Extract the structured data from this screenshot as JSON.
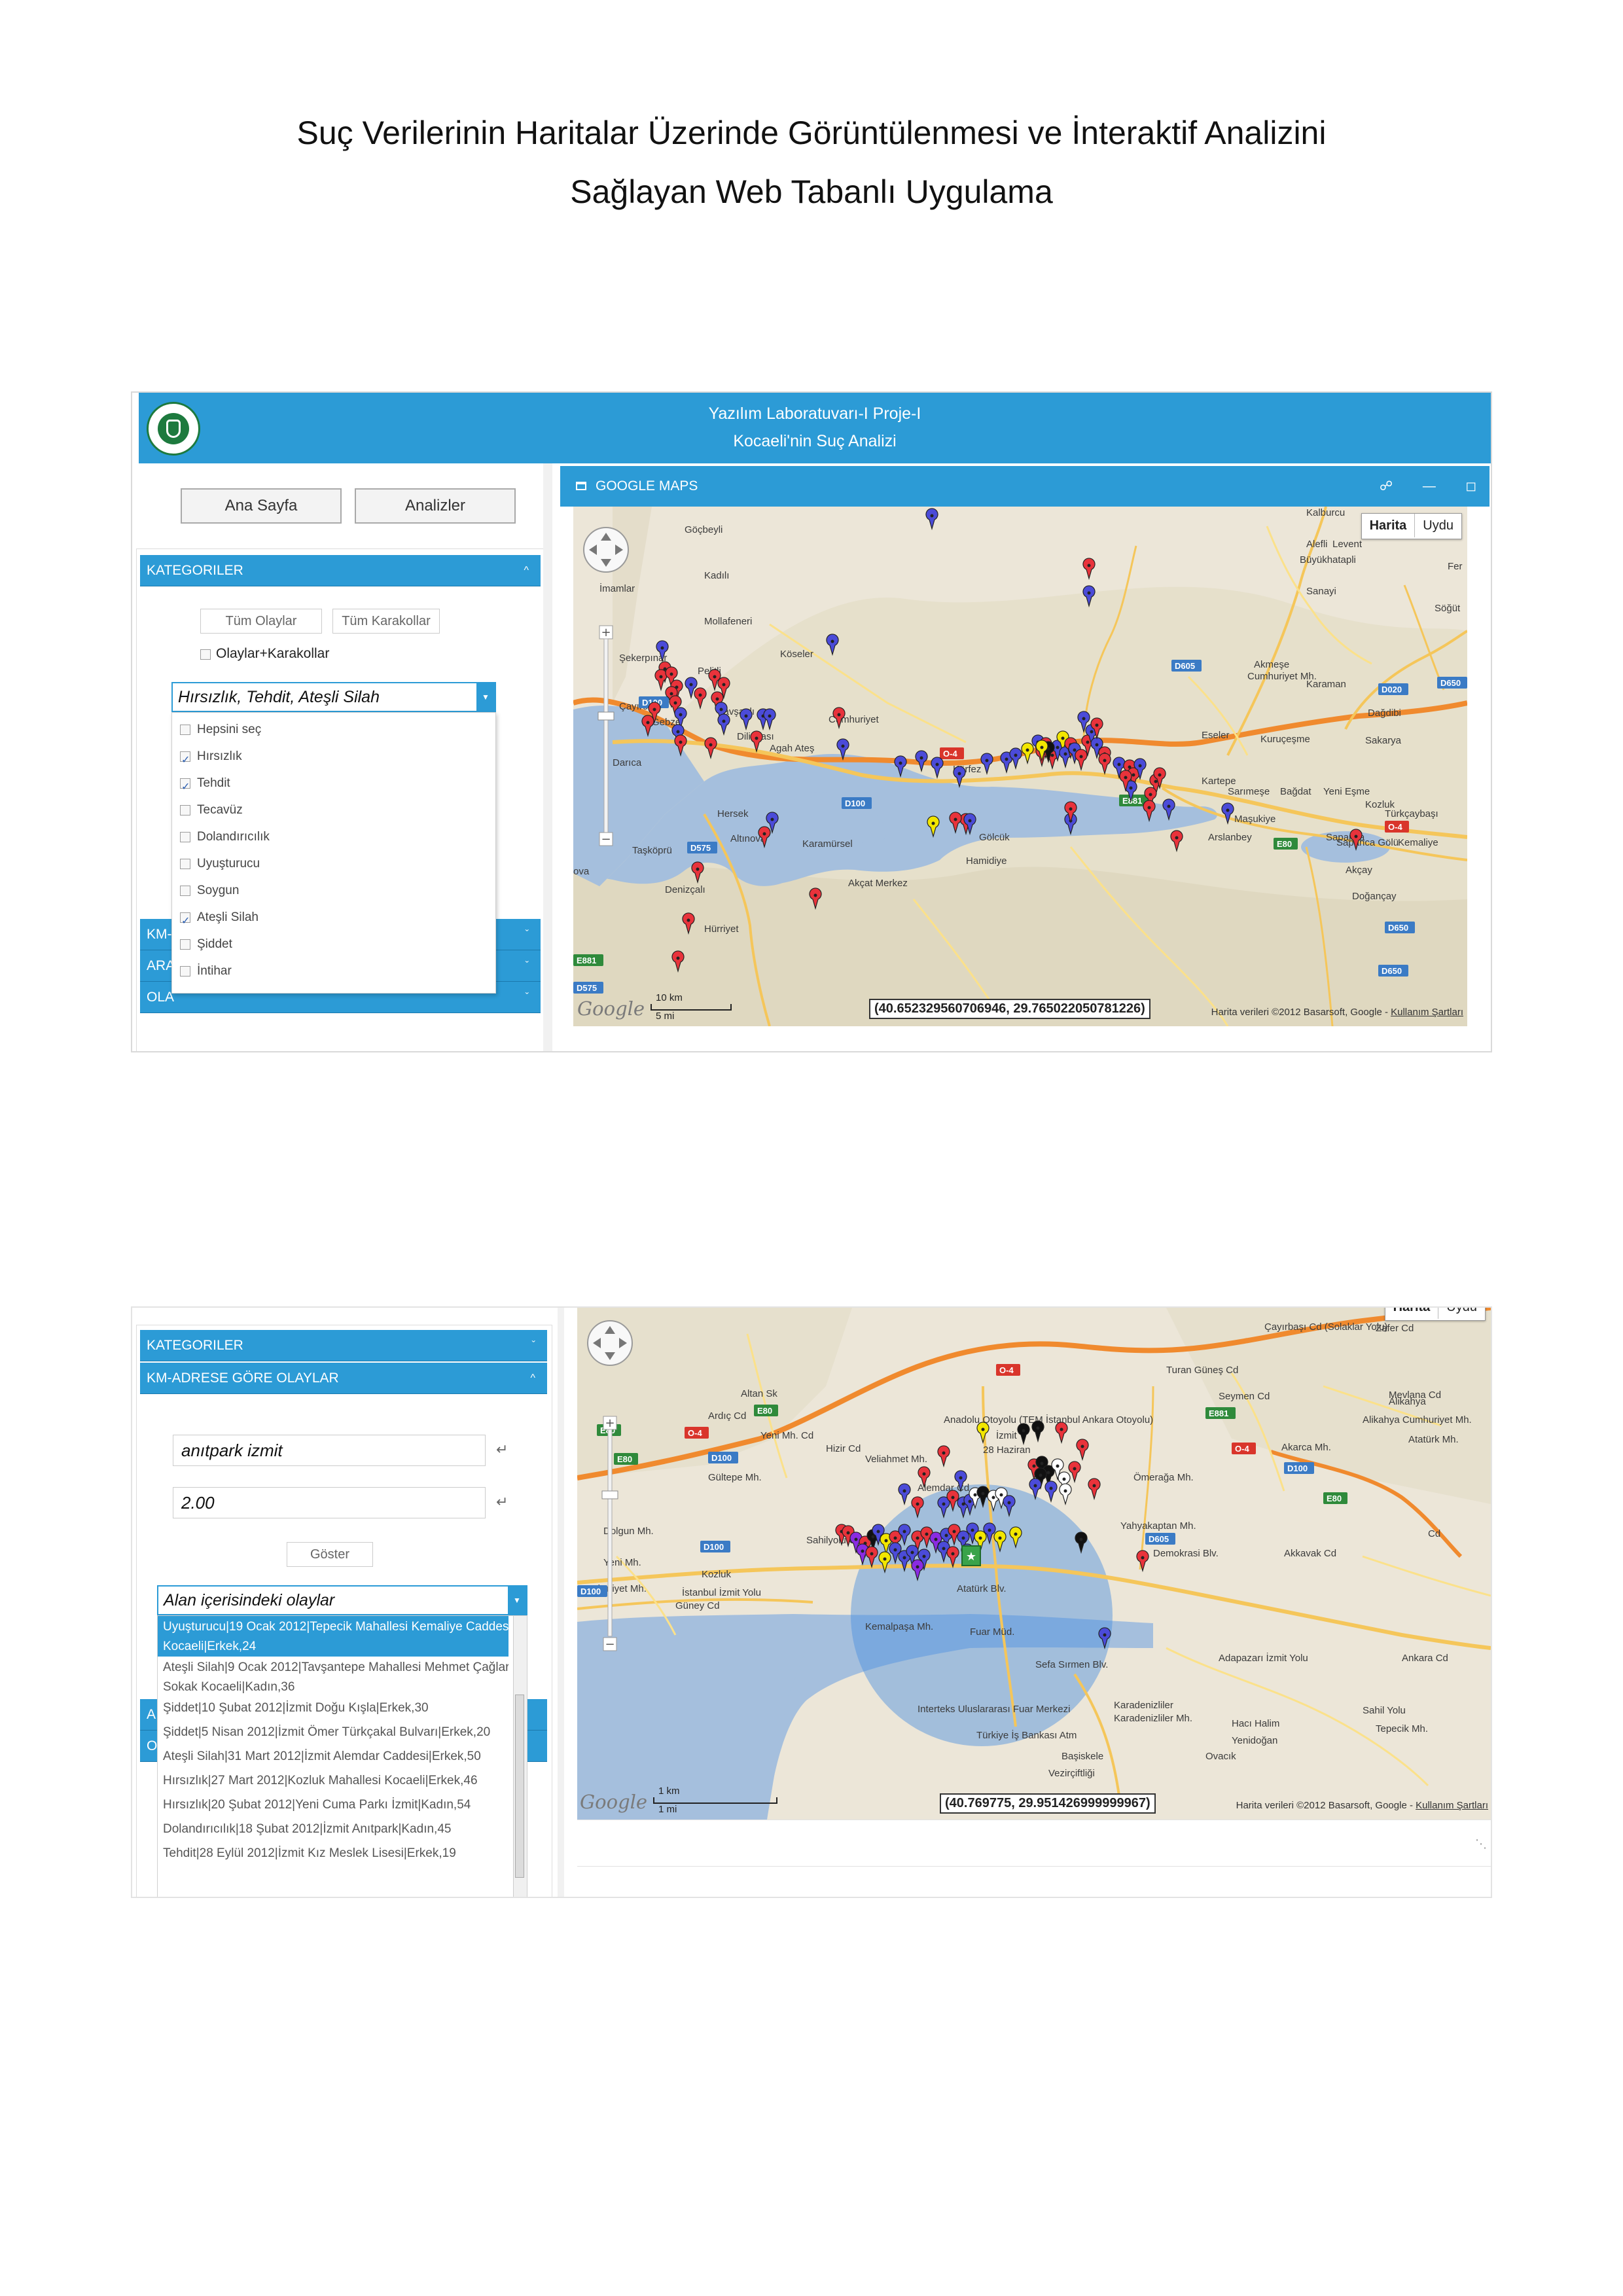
{
  "document": {
    "title_line1": "Suç Verilerinin Haritalar Üzerinde Görüntülenmesi ve İnteraktif Analizini",
    "title_line2": "Sağlayan Web Tabanlı Uygulama"
  },
  "colors": {
    "header_blue": "#2c9bd6",
    "pin_red": "#e8333b",
    "pin_blue": "#4b4bd8",
    "pin_yellow": "#f2e600",
    "pin_black": "#111111",
    "pin_white": "#ffffff",
    "pin_purple": "#8a2be2",
    "sea": "#a5bfdd"
  },
  "screen1": {
    "header": {
      "line1": "Yazılım Laboratuvarı-I Proje-I",
      "line2": "Kocaeli'nin Suç Analizi"
    },
    "nav": {
      "home": "Ana Sayfa",
      "analyses": "Analizler"
    },
    "categories": {
      "title": "KATEGORILER",
      "all_events": "Tüm Olaylar",
      "all_stations": "Tüm Karakollar",
      "events_stations": "Olaylar+Karakollar",
      "combo_value": "Hırsızlık, Tehdit, Ateşli Silah",
      "options": [
        {
          "label": "Hepsini seç",
          "checked": false
        },
        {
          "label": "Hırsızlık",
          "checked": true
        },
        {
          "label": "Tehdit",
          "checked": true
        },
        {
          "label": "Tecavüz",
          "checked": false
        },
        {
          "label": "Dolandırıcılık",
          "checked": false
        },
        {
          "label": "Uyuşturucu",
          "checked": false
        },
        {
          "label": "Soygun",
          "checked": false
        },
        {
          "label": "Ateşli Silah",
          "checked": true
        },
        {
          "label": "Şiddet",
          "checked": false
        },
        {
          "label": "İntihar",
          "checked": false
        }
      ],
      "collapsed_bars": [
        "KM-",
        "ARA",
        "OLA"
      ]
    },
    "map": {
      "panel_title": "GOOGLE MAPS",
      "map_types": [
        "Harita",
        "Uydu"
      ],
      "coords": "(40.652329560706946, 29.765022050781226)",
      "attribution": "Harita verileri ©2012 Basarsoft, Google -",
      "terms": "Kullanım Şartları",
      "google": "Google",
      "scale_km": "10 km",
      "scale_mi": "5 mi",
      "places": [
        "Kalburcu",
        "Göçbeyli",
        "Alefli",
        "Levent",
        "Büyükhatapli",
        "Fer",
        "Kadılı",
        "Sanayi",
        "İmamlar",
        "Söğüt",
        "Mollafeneri",
        "Köseler",
        "Şekerpınar",
        "Pelitli",
        "Akmeşe",
        "Cumhuriyet Mh.",
        "Karaman",
        "Çayırova",
        "Tavşanlı",
        "Cumhuriyet",
        "Dağdibi",
        "Gebze",
        "Diliovası",
        "Agah Ateş",
        "Kuruçeşme",
        "Sakarya",
        "Eseler",
        "Darıca",
        "Körfez",
        "Kartepe",
        "Sarımeşe",
        "Bağdat",
        "Yeni Eşme",
        "Kozluk",
        "Hersek",
        "Maşukiye",
        "Türkçaybaşı",
        "Altınova",
        "Gölcük",
        "Arslanbey",
        "Sapanca",
        "Karamürsel",
        "Kemaliye",
        "Taşköprü",
        "Hamidiye",
        "Akçay",
        "Denizçalı",
        "Akçat Merkez",
        "Doğançay",
        "Hürriyet",
        "ova",
        "Sapanca Gölü"
      ],
      "roads": [
        "D100",
        "O-4",
        "D605",
        "D020",
        "D650",
        "E881",
        "E80",
        "D575",
        "E881",
        "D650",
        "D575"
      ]
    }
  },
  "screen2": {
    "categories_title": "KATEGORILER",
    "km_title": "KM-ADRESE GÖRE OLAYLAR",
    "address_value": "anıtpark izmit",
    "distance_value": "2.00",
    "show_button": "Göster",
    "combo_value": "Alan içerisindeki olaylar",
    "collapsed_bars": [
      "A",
      "O"
    ],
    "events": [
      {
        "line1": "Uyuşturucu|19 Ocak 2012|Tepecik Mahallesi Kemaliye Caddesi",
        "line2": "Kocaeli|Erkek,24",
        "selected": true
      },
      {
        "line1": "Ateşli Silah|9 Ocak 2012|Tavşantepe Mahallesi Mehmet Çağlar",
        "line2": "Sokak Kocaeli|Kadın,36",
        "selected": false
      },
      {
        "line1": "Şiddet|10 Şubat 2012|İzmit Doğu Kışla|Erkek,30",
        "line2": "",
        "selected": false
      },
      {
        "line1": "Şiddet|5 Nisan 2012|İzmit Ömer Türkçakal Bulvarı|Erkek,20",
        "line2": "",
        "selected": false
      },
      {
        "line1": "Ateşli Silah|31 Mart 2012|İzmit Alemdar Caddesi|Erkek,50",
        "line2": "",
        "selected": false
      },
      {
        "line1": "Hırsızlık|27 Mart 2012|Kozluk Mahallesi Kocaeli|Erkek,46",
        "line2": "",
        "selected": false
      },
      {
        "line1": "Hırsızlık|20 Şubat 2012|Yeni Cuma Parkı İzmit|Kadın,54",
        "line2": "",
        "selected": false
      },
      {
        "line1": "Dolandırıcılık|18 Şubat 2012|İzmit Anıtpark|Kadın,45",
        "line2": "",
        "selected": false
      },
      {
        "line1": "Tehdit|28 Eylül 2012|İzmit Kız Meslek Lisesi|Erkek,19",
        "line2": "",
        "selected": false
      }
    ],
    "map": {
      "map_types": [
        "Harita",
        "Uydu"
      ],
      "coords": "(40.769775, 29.951426999999967)",
      "attribution": "Harita verileri ©2012 Basarsoft, Google -",
      "terms": "Kullanım Şartları",
      "google": "Google",
      "scale_km": "1 km",
      "scale_mi": "1 mi",
      "places": [
        "Zafer Cd",
        "Çayırbaşı Cd (Solaklar Yolu)",
        "Anadolu Otoyolu (TEM İstanbul Ankara Otoyolu)",
        "Mevlana Cd",
        "Alikahya",
        "Alikahya Cumhuriyet Mh.",
        "Atatürk Mh.",
        "Akarca Mh.",
        "Veliahmet Mh.",
        "İzmit",
        "Ömerağa Mh.",
        "Gültepe Mh.",
        "Yahyakaptan Mh.",
        "Dolgun Mh.",
        "Yeni Mh.",
        "Cumhuriyet Mh.",
        "Kozluk",
        "Kemalpaşa Mh.",
        "Fuar Müd.",
        "Karadenizliler",
        "Karadenizliler Mh.",
        "Hacı Halim",
        "Tepecik Mh.",
        "Yenidoğan",
        "Başiskele",
        "Ovacık",
        "Vezirçiftliği",
        "Türkiye İş Bankası Atm",
        "Interteks Uluslararası Fuar Merkezi",
        "Güney Cd",
        "İstanbul İzmit Yolu",
        "Adapazarı İzmit Yolu",
        "Ankara Cd",
        "Sahil Yolu",
        "Atatürk Blv.",
        "Sefa Sırmen Blv.",
        "Seymen Cd",
        "Turan Güneş Cd",
        "Akkavak Cd",
        "Demokrasi Blv.",
        "Cd",
        "Sahilyolu Cd",
        "Hizir Cd",
        "28 Haziran",
        "Alemdar Cd",
        "Altan Sk",
        "Ardıç Cd",
        "Yeni Mh. Cd"
      ],
      "roads": [
        "O-4",
        "E80",
        "D100",
        "E881",
        "D605",
        "D100",
        "E80",
        "O-4",
        "E80",
        "D100",
        "D100",
        "E80",
        "O-4"
      ]
    }
  }
}
